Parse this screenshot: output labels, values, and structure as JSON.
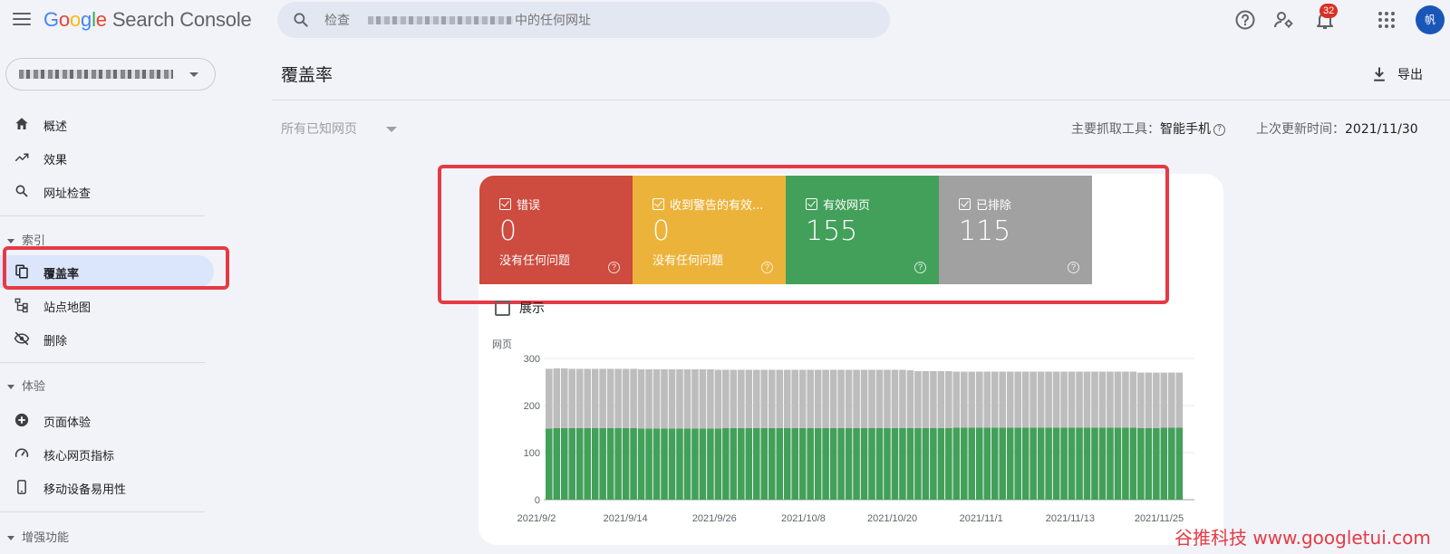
{
  "app": {
    "logo_letters": [
      "G",
      "o",
      "o",
      "g",
      "l",
      "e"
    ],
    "product": "Search Console",
    "search_placeholder": "检查             中的任何网址",
    "notification_count": "32",
    "avatar_letter": "帆"
  },
  "sidebar": {
    "items": [
      {
        "label": "概述",
        "icon": "home-icon"
      },
      {
        "label": "效果",
        "icon": "trending-up-icon"
      },
      {
        "label": "网址检查",
        "icon": "search-icon"
      }
    ],
    "section_index": "索引",
    "index_items": [
      {
        "label": "覆盖率",
        "icon": "copy-icon",
        "active": true
      },
      {
        "label": "站点地图",
        "icon": "sitemap-icon"
      },
      {
        "label": "删除",
        "icon": "visibility-off-icon"
      }
    ],
    "section_experience": "体验",
    "experience_items": [
      {
        "label": "页面体验",
        "icon": "add-circle-icon"
      },
      {
        "label": "核心网页指标",
        "icon": "speed-gauge-icon"
      },
      {
        "label": "移动设备易用性",
        "icon": "smartphone-icon"
      }
    ],
    "section_enhance": "增强功能"
  },
  "main": {
    "title": "覆盖率",
    "export_label": "导出",
    "filter_label": "所有已知网页",
    "crawler_label": "主要抓取工具：",
    "crawler_value": "智能手机",
    "updated_label": "上次更新时间：",
    "updated_value": "2021/11/30",
    "show_label": "展示",
    "tiles": [
      {
        "label": "错误",
        "value": "0",
        "sub": "没有任何问题",
        "color": "#cd4b3f"
      },
      {
        "label": "收到警告的有效...",
        "value": "0",
        "sub": "没有任何问题",
        "color": "#ecb33b"
      },
      {
        "label": "有效网页",
        "value": "155",
        "sub": "",
        "color": "#43a05a"
      },
      {
        "label": "已排除",
        "value": "115",
        "sub": "",
        "color": "#a1a1a1"
      }
    ]
  },
  "watermark": "谷推科技 www.googletui.com",
  "chart_data": {
    "type": "bar",
    "stacked": true,
    "ylabel": "网页",
    "ylim": [
      0,
      300
    ],
    "yticks": [
      0,
      100,
      200,
      300
    ],
    "xtick_labels": [
      "2021/9/2",
      "2021/9/14",
      "2021/9/26",
      "2021/10/8",
      "2021/10/20",
      "2021/11/1",
      "2021/11/13",
      "2021/11/25"
    ],
    "series": [
      {
        "name": "有效网页",
        "color": "#43a05a",
        "values": [
          151,
          152,
          152,
          152,
          152,
          152,
          152,
          152,
          152,
          152,
          152,
          152,
          151,
          151,
          151,
          151,
          151,
          151,
          151,
          151,
          151,
          151,
          151,
          152,
          152,
          152,
          152,
          152,
          152,
          152,
          152,
          152,
          152,
          152,
          152,
          152,
          152,
          152,
          152,
          152,
          152,
          152,
          152,
          152,
          152,
          152,
          152,
          152,
          152,
          152,
          152,
          152,
          152,
          153,
          153,
          153,
          153,
          153,
          153,
          153,
          153,
          153,
          153,
          153,
          153,
          153,
          153,
          153,
          153,
          153,
          153,
          153,
          153,
          153,
          153,
          153,
          153,
          152,
          152,
          152,
          153,
          153,
          153
        ]
      },
      {
        "name": "已排除",
        "color": "#bdbdbd",
        "values": [
          127,
          127,
          127,
          126,
          126,
          126,
          126,
          126,
          126,
          126,
          126,
          126,
          126,
          126,
          126,
          126,
          126,
          126,
          126,
          126,
          126,
          126,
          125,
          124,
          124,
          124,
          124,
          124,
          124,
          124,
          124,
          124,
          124,
          124,
          124,
          124,
          124,
          124,
          124,
          124,
          124,
          124,
          124,
          124,
          124,
          124,
          124,
          123,
          121,
          121,
          121,
          121,
          121,
          119,
          119,
          119,
          119,
          119,
          119,
          119,
          119,
          119,
          119,
          119,
          119,
          119,
          119,
          119,
          119,
          119,
          119,
          119,
          119,
          119,
          119,
          119,
          119,
          118,
          118,
          118,
          117,
          117,
          117
        ]
      }
    ],
    "grid": true
  }
}
